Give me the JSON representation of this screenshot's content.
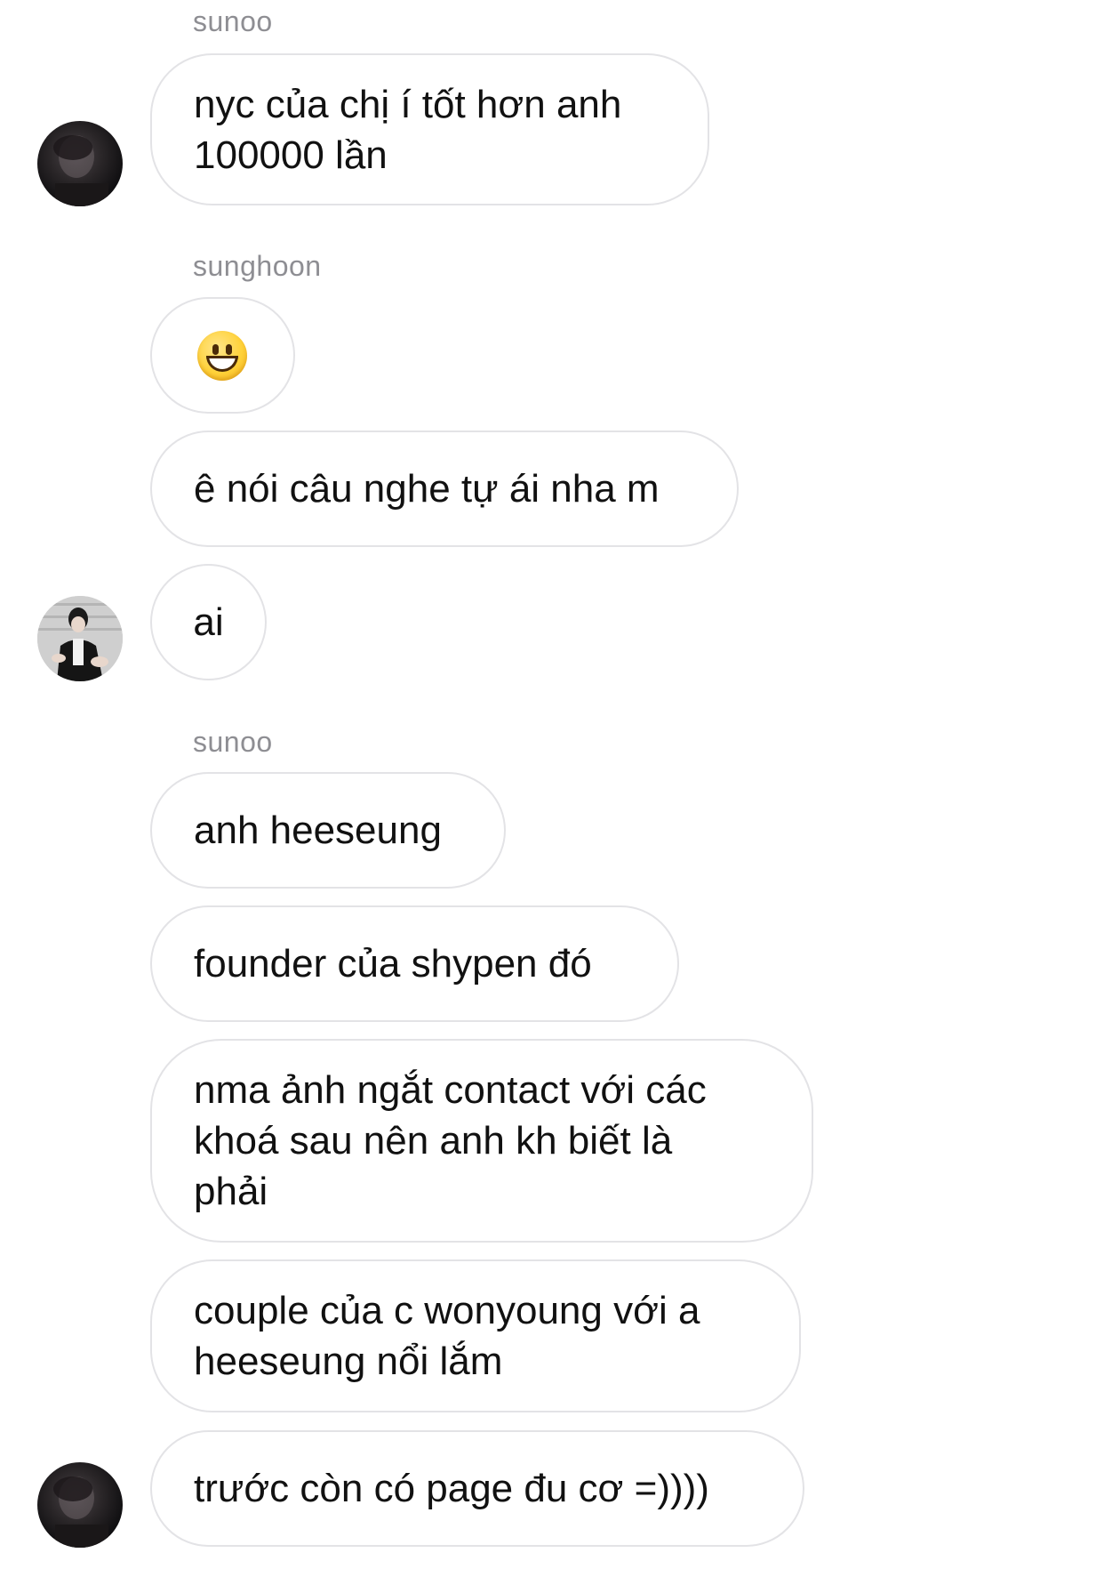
{
  "messages": [
    {
      "sender": "sunoo",
      "text": "nyc của chị í tốt hơn anh\n100000 lần"
    },
    {
      "sender": "sunghoon",
      "emoji": "grinning-face",
      "text": "ê nói câu nghe tự ái nha m"
    },
    {
      "text": "ai"
    },
    {
      "sender": "sunoo",
      "text": "anh heeseung"
    },
    {
      "text": "founder của shypen đó"
    },
    {
      "text": "nma ảnh ngắt contact với các\nkhoá sau nên anh kh biết là\nphải"
    },
    {
      "text": "couple của c wonyoung với a\nheeseung nổi lắm"
    },
    {
      "text": "trước còn có page đu cơ =))))"
    }
  ]
}
